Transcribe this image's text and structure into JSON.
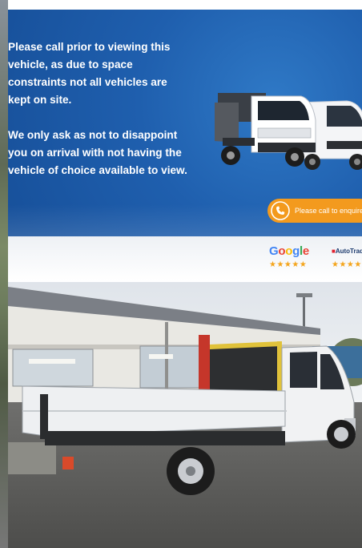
{
  "banner": {
    "notice_p1": "Please call prior to viewing this vehicle, as due to space constraints not all vehicles are kept on site.",
    "notice_p2": "We only ask as not to disappoint you on arrival with not having the vehicle of choice available to view.",
    "call_button_label": "Please call to enquire",
    "review_sources": [
      "Google",
      "AutoTrader"
    ],
    "review_stars": "★★★★★",
    "colors": {
      "blue": "#1f5fae",
      "orange": "#f39a1e",
      "star": "#f4a51c"
    }
  },
  "photo": {
    "icons": [
      "truck-icon",
      "van-icon"
    ]
  }
}
